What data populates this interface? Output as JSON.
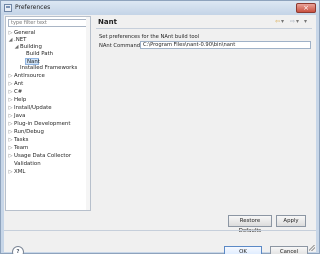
{
  "window": {
    "title": "Preferences",
    "close_symbol": "×"
  },
  "left": {
    "filter_placeholder": "type filter text",
    "items": [
      {
        "label": "General",
        "arrow": "▷",
        "indent": 0
      },
      {
        "label": ".NET",
        "arrow": "◢",
        "indent": 0
      },
      {
        "label": "Building",
        "arrow": "◢",
        "indent": 1
      },
      {
        "label": "Build Path",
        "arrow": "",
        "indent": 2
      },
      {
        "label": "Nant",
        "arrow": "",
        "indent": 2,
        "selected": true
      },
      {
        "label": "Installed Frameworks",
        "arrow": "",
        "indent": 1
      },
      {
        "label": "Antlrsource",
        "arrow": "▷",
        "indent": 0
      },
      {
        "label": "Ant",
        "arrow": "▷",
        "indent": 0
      },
      {
        "label": "C#",
        "arrow": "▷",
        "indent": 0
      },
      {
        "label": "Help",
        "arrow": "▷",
        "indent": 0
      },
      {
        "label": "Install/Update",
        "arrow": "▷",
        "indent": 0
      },
      {
        "label": "Java",
        "arrow": "▷",
        "indent": 0
      },
      {
        "label": "Plug-in Development",
        "arrow": "▷",
        "indent": 0
      },
      {
        "label": "Run/Debug",
        "arrow": "▷",
        "indent": 0
      },
      {
        "label": "Tasks",
        "arrow": "▷",
        "indent": 0
      },
      {
        "label": "Team",
        "arrow": "▷",
        "indent": 0
      },
      {
        "label": "Usage Data Collector",
        "arrow": "▷",
        "indent": 0
      },
      {
        "label": "Validation",
        "arrow": "",
        "indent": 0
      },
      {
        "label": "XML",
        "arrow": "▷",
        "indent": 0
      }
    ]
  },
  "panel": {
    "title": "Nant",
    "description": "Set preferences for the NAnt build tool",
    "command_label": "NAnt Command:",
    "command_value": "C:\\Program Files\\nant-0.90\\bin\\nant",
    "restore_label": "Restore Defaults",
    "apply_label": "Apply"
  },
  "dialog": {
    "help_symbol": "?",
    "ok_label": "OK",
    "cancel_label": "Cancel"
  },
  "toolbar_icons": [
    "back-arrow-icon",
    "dropdown-arrow-icon",
    "forward-arrow-icon",
    "dropdown-arrow-icon",
    "menu-icon"
  ]
}
